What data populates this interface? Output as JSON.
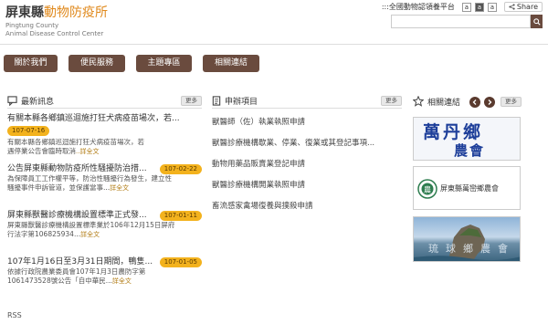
{
  "header": {
    "title_main": "屏東縣",
    "title_accent": "動物防疫所",
    "subtitle_line1": "Pingtung County",
    "subtitle_line2": "Animal Disease Control Center"
  },
  "topbar": {
    "platform_link": ":::全國動物認領養平台",
    "size_small": "a",
    "size_medium": "a",
    "size_large": "a",
    "share_label": "Share"
  },
  "search": {
    "placeholder": ""
  },
  "nav": [
    {
      "label": "關於我們"
    },
    {
      "label": "便民服務"
    },
    {
      "label": "主題專區"
    },
    {
      "label": "相關連結"
    }
  ],
  "news": {
    "title": "最新訊息",
    "more": "更多",
    "items": [
      {
        "title": "有關本縣各鄉鎮巡迴施打狂犬病疫苗場次，若...",
        "date": "107-07-16",
        "desc1": "有關本縣各鄉鎮巡迴施打狂犬病疫苗場次，若",
        "desc2": "遇停業公告會臨時取消",
        "readmore": "..詳全文"
      },
      {
        "title": "公告屏東縣動物防疫所性騷擾防治措...",
        "date": "107-02-22",
        "desc1": "為保障員工工作權平等，防治性騷擾行為發生，建立性",
        "desc2": "騷擾事件申訴管道，並保護當事...",
        "readmore": "詳全文"
      },
      {
        "title": "屏東縣獸醫診療機構設置標準正式發...",
        "date": "107-01-11",
        "desc1": "屏東縣獸醫診療機構設置標準業於106年12月15日屏府",
        "desc2": "行法字第106825934...",
        "readmore": "詳全文"
      },
      {
        "title": "107年1月16日至3月31日期間，鴨隻...",
        "date": "107-01-05",
        "desc1": "依據行政院農業委員會107年1月3日農防字第",
        "desc2": "1061473528號公告「自中華民...",
        "readmore": "詳全文"
      }
    ],
    "rss": "RSS"
  },
  "apply": {
    "title": "申辦項目",
    "more": "更多",
    "items": [
      "獸醫師（佐）執業執照申請",
      "獸醫診療機構歇業、停業、復業或其登記事項...",
      "動物用藥品販賣業登記申請",
      "獸醫診療機構開業執照申請",
      "畜流感家禽場復養與撲殺申請"
    ]
  },
  "links": {
    "title": "相關連結",
    "more": "更多",
    "banners": [
      {
        "line1": "萬丹鄉",
        "line2": "農會"
      },
      {
        "name": "屏東縣萬巒鄉農會"
      },
      {
        "overlay": "琉球鄉農會"
      }
    ]
  },
  "colors": {
    "nav_bg": "#6a4b3e",
    "accent": "#e08a1e",
    "date_badge": "#f3b21d"
  }
}
